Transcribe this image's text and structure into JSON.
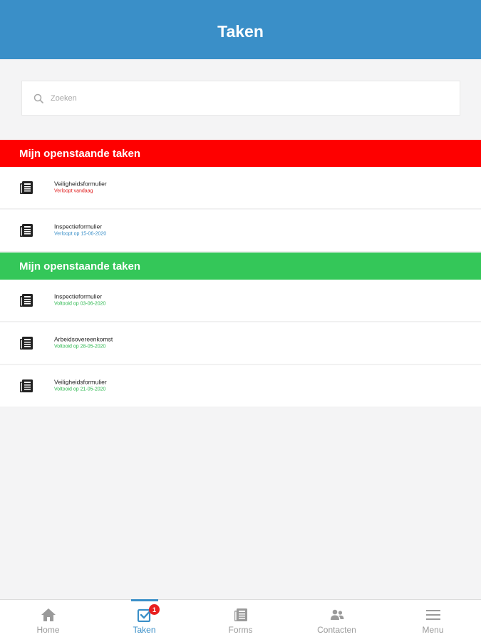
{
  "header": {
    "title": "Taken"
  },
  "search": {
    "placeholder": "Zoeken",
    "value": ""
  },
  "colors": {
    "header": "#3a8fc8",
    "open_section": "#fe0000",
    "done_section": "#34c759",
    "overdue": "#e02020",
    "due": "#3a8fc8",
    "done": "#2db84f"
  },
  "sections": [
    {
      "title": "Mijn openstaande taken",
      "color": "#fe0000",
      "items": [
        {
          "title": "Veiligheidsformulier",
          "subtitle": "Verloopt vandaag",
          "subtitle_color": "#e02020",
          "icon": "document-icon"
        },
        {
          "title": "Inspectieformulier",
          "subtitle": "Verloopt op 15-06-2020",
          "subtitle_color": "#3a8fc8",
          "icon": "document-icon"
        }
      ]
    },
    {
      "title": "Mijn openstaande taken",
      "color": "#34c759",
      "items": [
        {
          "title": "Inspectieformulier",
          "subtitle": "Voltooid op 03-06-2020",
          "subtitle_color": "#2db84f",
          "icon": "document-icon"
        },
        {
          "title": "Arbeidsovereenkomst",
          "subtitle": "Voltooid op 28-05-2020",
          "subtitle_color": "#2db84f",
          "icon": "document-icon"
        },
        {
          "title": "Veiligheidsformulier",
          "subtitle": "Voltooid op 21-05-2020",
          "subtitle_color": "#2db84f",
          "icon": "document-icon"
        }
      ]
    }
  ],
  "tabbar": {
    "tabs": [
      {
        "label": "Home",
        "icon": "home-icon",
        "active": false
      },
      {
        "label": "Taken",
        "icon": "tasks-icon",
        "active": true,
        "badge": "1"
      },
      {
        "label": "Forms",
        "icon": "forms-icon",
        "active": false
      },
      {
        "label": "Contacten",
        "icon": "contacts-icon",
        "active": false
      },
      {
        "label": "Menu",
        "icon": "menu-icon",
        "active": false
      }
    ]
  }
}
